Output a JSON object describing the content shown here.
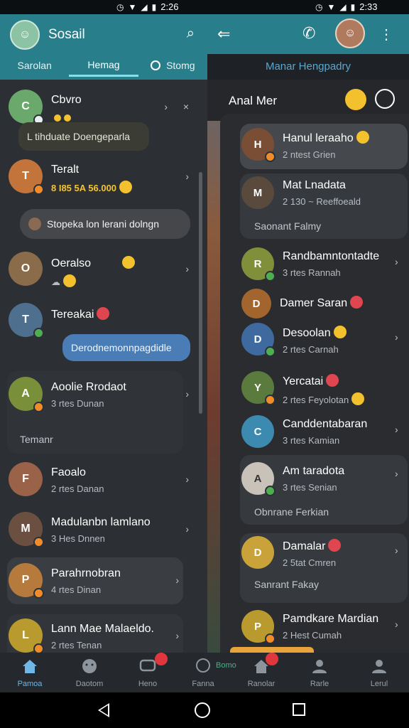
{
  "status": {
    "left_time": "2:26",
    "right_time": "2:33"
  },
  "left": {
    "title": "Sosail",
    "tabs": [
      {
        "label": "Sarolan"
      },
      {
        "label": "Hemag"
      },
      {
        "label": "Stomg"
      }
    ],
    "chats": [
      {
        "name": "Cbvro",
        "sub": "",
        "bubble": "L tihduate Doengeparla",
        "initial": "C",
        "color": "#6aa86b"
      },
      {
        "name": "Teralt",
        "sub": "8 I85 5A 56.000",
        "initial": "T",
        "color": "#c2743a"
      },
      {
        "name": "Oeralso",
        "sub": "",
        "initial": "O",
        "color": "#8b6c4a"
      },
      {
        "name": "Tereakai",
        "sub": "",
        "initial": "T",
        "color": "#4f6f8f"
      },
      {
        "name": "Aoolie Rrodaot",
        "sub": "3 rtes Dunan",
        "initial": "A",
        "color": "#7a8f3a"
      },
      {
        "name": "Faoalo",
        "sub": "2 rtes Danan",
        "initial": "F",
        "color": "#9a6248"
      },
      {
        "name": "Madulanbn lamlano",
        "sub": "3 Hes Dnnen",
        "initial": "M",
        "color": "#6b5042"
      },
      {
        "name": "Parahrnobran",
        "sub": "4 rtes Dinan",
        "initial": "P",
        "color": "#b57a3c"
      },
      {
        "name": "Lann Mae Malaeldo.",
        "sub": "2 rtes Tenan",
        "initial": "L",
        "color": "#b99a2e"
      }
    ],
    "system_bubble": "Stopeka lon lerani dolngn",
    "blue_bubble": "Derodnemonnpagdidle",
    "note": "Temanr"
  },
  "right": {
    "subtitle": "Manar Hengpadry",
    "chat_title": "Anal Mer",
    "contacts": [
      {
        "name": "Hanul leraaho",
        "sub": "2 ntest Grien",
        "initial": "H",
        "color": "#7a4e34"
      },
      {
        "name": "Mat Lnadata",
        "sub": "2 130 ~ Reeffoeald",
        "initial": "M",
        "color": "#5a4a3e"
      },
      {
        "name": "Randbamntontadte",
        "sub": "3 rtes Rannah",
        "initial": "R",
        "color": "#7f8f3a"
      },
      {
        "name": "Damer Saran",
        "sub": "",
        "initial": "D",
        "color": "#a2652e"
      },
      {
        "name": "Desoolan",
        "sub": "2 rtes Carnah",
        "initial": "D",
        "color": "#3f6aa0"
      },
      {
        "name": "Yercatai",
        "sub": "2 rtes Feyolotan",
        "initial": "Y",
        "color": "#5a7a3e"
      },
      {
        "name": "Canddentabaran",
        "sub": "3 rtes Kamian",
        "initial": "C",
        "color": "#3c8ab0"
      },
      {
        "name": "Am taradota",
        "sub": "3 rtes Senian",
        "initial": "A",
        "color": "#c8c2b8"
      },
      {
        "name": "Damalar",
        "sub": "2 5tat Cmren",
        "initial": "D",
        "color": "#c9a23a"
      },
      {
        "name": "Pamdkare Mardian",
        "sub": "2 Hest Cumah",
        "initial": "P",
        "color": "#b99a2e"
      }
    ],
    "notes": [
      "Saonant Falmy",
      "Obnrane Ferkian",
      "Sanrant Fakay"
    ]
  },
  "nav": [
    {
      "label": "Pamoa",
      "icon": "home-icon"
    },
    {
      "label": "Daotom",
      "icon": "sad-face-icon"
    },
    {
      "label": "Heno",
      "icon": "chat-icon",
      "badge": ""
    },
    {
      "label": "Fanna",
      "icon": "chat-bubble-icon",
      "extra": "Bomo"
    },
    {
      "label": "Ranolar",
      "icon": "home-icon",
      "badge": ""
    },
    {
      "label": "Rarle",
      "icon": "person-icon"
    },
    {
      "label": "Lerul",
      "icon": "person-icon"
    }
  ],
  "colors": {
    "accent": "#287f8b",
    "active": "#6fb7e6",
    "badge": "#e0373f"
  }
}
